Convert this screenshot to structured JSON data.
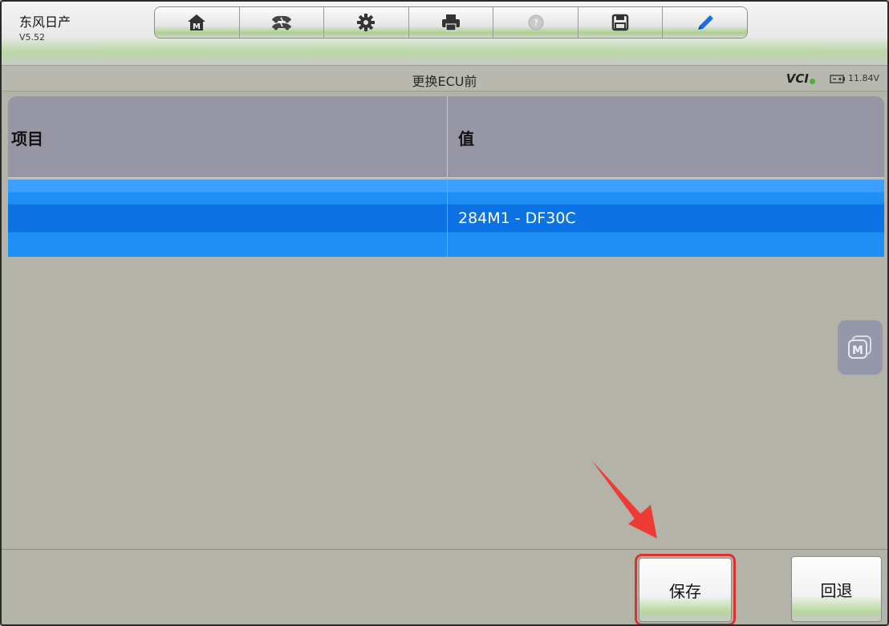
{
  "app": {
    "name": "东风日产",
    "version": "V5.52"
  },
  "toolbar": {
    "buttons": [
      {
        "icon": "home-icon"
      },
      {
        "icon": "vehicle-swap-icon"
      },
      {
        "icon": "settings-gear-icon"
      },
      {
        "icon": "printer-icon"
      },
      {
        "icon": "help-icon"
      },
      {
        "icon": "save-disk-icon"
      },
      {
        "icon": "pen-icon"
      }
    ]
  },
  "header": {
    "title": "更换ECU前",
    "vci_label": "VCI",
    "battery_voltage": "11.84V"
  },
  "table": {
    "columns": [
      "项目",
      "值"
    ],
    "rows": [
      {
        "item": "",
        "value": "284M1 - DF30C"
      }
    ]
  },
  "float_button": {
    "icon": "m-float-icon"
  },
  "footer": {
    "save_label": "保存",
    "back_label": "回退"
  },
  "colors": {
    "selected_row": "#0d73e4",
    "header_bg": "#9696a4",
    "highlight_box": "#e03030",
    "arrow": "#ee3b36"
  }
}
